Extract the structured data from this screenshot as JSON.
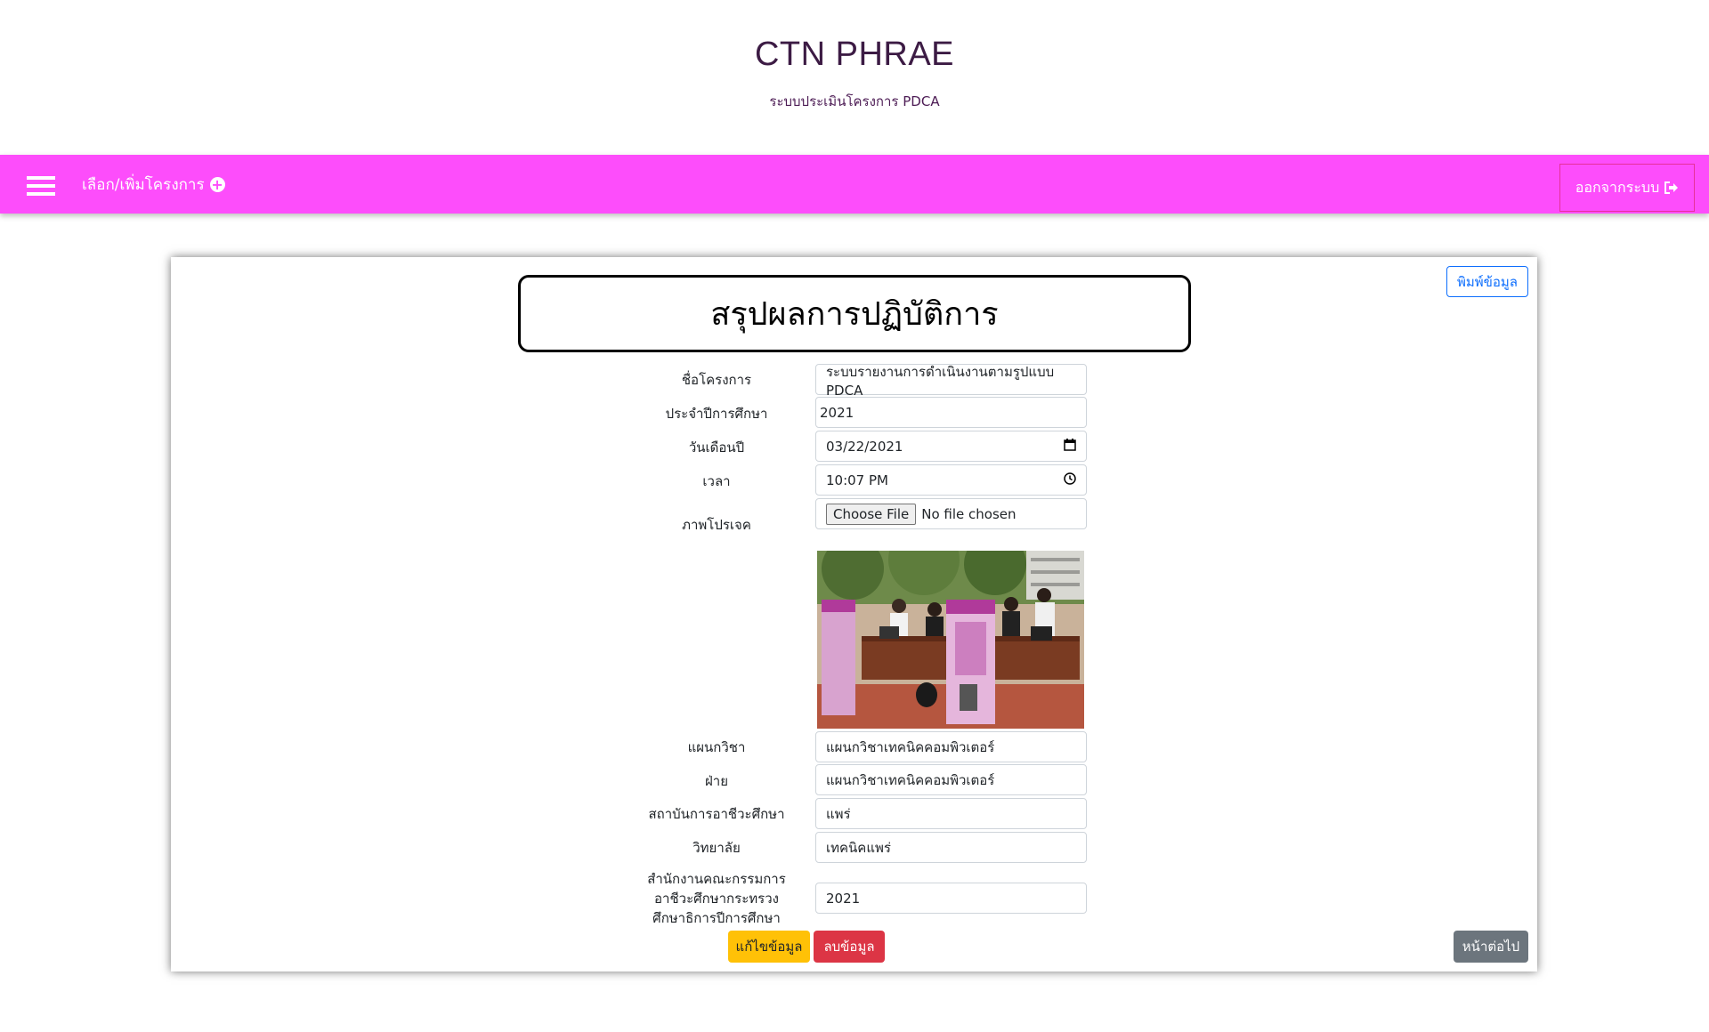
{
  "header": {
    "title": "CTN PHRAE",
    "subtitle": "ระบบประเมินโครงการ PDCA"
  },
  "navbar": {
    "menu_icon": "hamburger-icon",
    "select_project_label": "เลือก/เพิ่มโครงการ",
    "select_project_icon": "plus-circle-icon",
    "logout_label": "ออกจากระบบ",
    "logout_icon": "sign-out-icon",
    "background_color": "#fd4dfb"
  },
  "card": {
    "print_label": "พิมพ์ข้อมูล",
    "title": "สรุปผลการปฏิบัติการ",
    "fields": {
      "project_name": {
        "label": "ชื่อโครงการ",
        "value": "ระบบรายงานการดำเนินงานตามรูปแบบ PDCA"
      },
      "academic_year": {
        "label": "ประจำปีการศึกษา",
        "value": "2021"
      },
      "date": {
        "label": "วันเดือนปี",
        "value": "03/22/2021"
      },
      "time": {
        "label": "เวลา",
        "value": "10:07 PM"
      },
      "project_image": {
        "label": "ภาพโปรเจค",
        "file_button": "Choose File",
        "file_status": "No file chosen"
      },
      "department": {
        "label": "แผนกวิชา",
        "value": "แผนกวิชาเทคนิคคอมพิวเตอร์"
      },
      "division": {
        "label": "ฝ่าย",
        "value": "แผนกวิชาเทคนิคคอมพิวเตอร์"
      },
      "institute": {
        "label": "สถาบันการอาชีวะศึกษา",
        "value": "แพร่"
      },
      "college": {
        "label": "วิทยาลัย",
        "value": "เทคนิคแพร่"
      },
      "office": {
        "label_line1": "สำนักงานคณะกรรมการ",
        "label_line2": "อาชีวะศึกษากระทรวง",
        "label_line3": "ศึกษาธิการปีการศึกษา",
        "value": "2021"
      }
    },
    "buttons": {
      "edit": "แก้ไขข้อมูล",
      "delete": "ลบข้อมูล",
      "next": "หน้าต่อไป"
    }
  }
}
